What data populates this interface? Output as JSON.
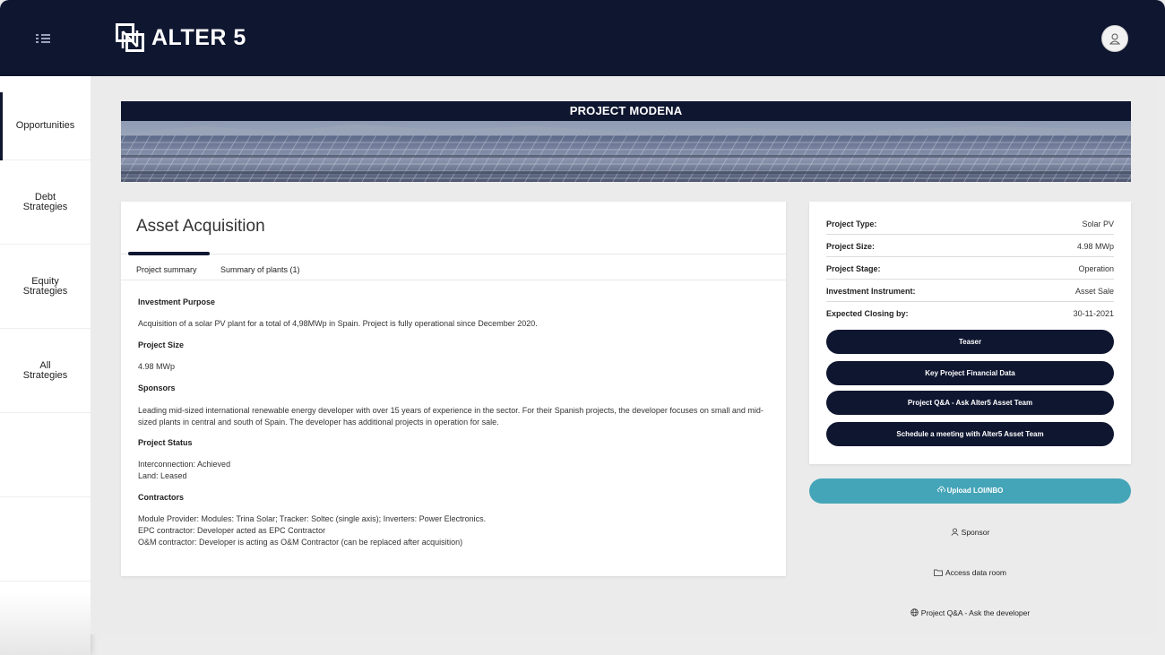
{
  "app": {
    "logo_text": "ALTER 5"
  },
  "sidebar": {
    "items": [
      {
        "label": "Opportunities"
      },
      {
        "label": "Debt\nStrategies"
      },
      {
        "label": "Equity\nStrategies"
      },
      {
        "label": "All\nStrategies"
      }
    ]
  },
  "banner": {
    "title": "PROJECT MODENA"
  },
  "project": {
    "title": "Asset Acquisition",
    "tabs": [
      {
        "label": "Project summary"
      },
      {
        "label": "Summary of plants (1)"
      }
    ],
    "sections": {
      "purpose_heading": "Investment Purpose",
      "purpose_text": "Acquisition of a solar PV plant for a total of 4,98MWp in Spain. Project is fully operational since December 2020.",
      "size_heading": "Project Size",
      "size_text": "4.98 MWp",
      "sponsors_heading": "Sponsors",
      "sponsors_text": "Leading mid-sized international renewable energy developer with over 15 years of experience in the sector. For their Spanish projects, the developer focuses on small and mid-sized plants in central and south of Spain. The developer has additional projects in operation for sale.",
      "status_heading": "Project Status",
      "status_line1": "Interconnection: Achieved",
      "status_line2": "Land: Leased",
      "contractors_heading": "Contractors",
      "contractors_line1": "Module Provider: Modules: Trina Solar; Tracker: Soltec (single axis); Inverters: Power Electronics.",
      "contractors_line2": "EPC contractor: Developer acted as EPC Contractor",
      "contractors_line3": "O&M contractor: Developer is acting as O&M Contractor (can be replaced after acquisition)"
    }
  },
  "details": {
    "rows": [
      {
        "key": "Project Type:",
        "value": "Solar PV"
      },
      {
        "key": "Project Size:",
        "value": "4.98 MWp"
      },
      {
        "key": "Project Stage:",
        "value": "Operation"
      },
      {
        "key": "Investment Instrument:",
        "value": "Asset Sale"
      },
      {
        "key": "Expected Closing by:",
        "value": "30-11-2021"
      }
    ],
    "buttons": [
      {
        "label": "Teaser"
      },
      {
        "label": "Key Project Financial Data"
      },
      {
        "label": "Project Q&A - Ask Alter5 Asset Team"
      },
      {
        "label": "Schedule a meeting with Alter5 Asset Team"
      }
    ]
  },
  "actions": {
    "upload_label": "Upload LOI/NBO",
    "sponsor_label": "Sponsor",
    "data_room_label": "Access data room",
    "qa_label": "Project Q&A - Ask the developer"
  },
  "colors": {
    "navy": "#0f1630",
    "teal": "#45a5b8",
    "background": "#ebebeb"
  },
  "icons": [
    "menu-icon",
    "user-icon",
    "cloud-upload-icon",
    "person-icon",
    "folder-icon",
    "globe-icon"
  ]
}
